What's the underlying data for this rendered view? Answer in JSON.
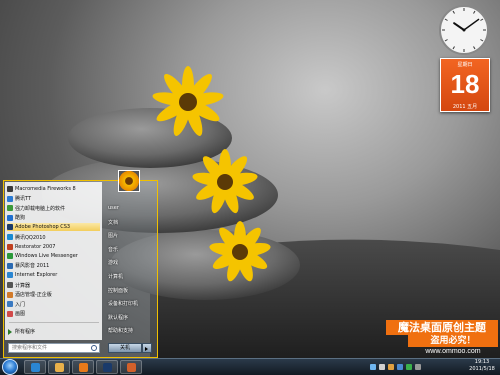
{
  "gadgets": {
    "calendar": {
      "weekday": "星期日",
      "day": "18",
      "year_month": "2011 五月"
    },
    "clock": {
      "hour": 10,
      "minute": 9
    }
  },
  "start_menu": {
    "programs": [
      {
        "label": "Macromedia Fireworks 8",
        "color": "#3a3a3a"
      },
      {
        "label": "腾讯TT",
        "color": "#2a7ad2"
      },
      {
        "label": "强力卸载电脑上的软件",
        "color": "#3a9a3a"
      },
      {
        "label": "酷狗",
        "color": "#1f6fd0"
      },
      {
        "label": "Adobe Photoshop CS3",
        "color": "#1a3a6a",
        "highlighted": true
      },
      {
        "label": "腾讯QQ2010",
        "color": "#1a8ad2"
      },
      {
        "label": "Restorator 2007",
        "color": "#c04020"
      },
      {
        "label": "Windows Live Messenger",
        "color": "#2a9a3a"
      },
      {
        "label": "暴风影音 2011",
        "color": "#2a6ab2"
      },
      {
        "label": "Internet Explorer",
        "color": "#2a86d2"
      },
      {
        "label": "计算器",
        "color": "#555"
      },
      {
        "label": "酒店管理-正企版",
        "color": "#d27a2a"
      },
      {
        "label": "入门",
        "color": "#3a7ac2"
      },
      {
        "label": "画图",
        "color": "#d24a4a"
      }
    ],
    "all_programs": "所有程序",
    "search_placeholder": "搜索程序和文件",
    "right_items": [
      "user",
      "文档",
      "图片",
      "音乐",
      "游戏",
      "计算机",
      "控制面板",
      "设备和打印机",
      "默认程序",
      "帮助和支持"
    ],
    "shutdown_label": "关机"
  },
  "watermark": {
    "line1": "魔法桌面原创主题",
    "line2": "盗用必究！",
    "line3": "www.ommoo.com"
  },
  "taskbar": {
    "time": "19:13",
    "date": "2011/5/18",
    "buttons": [
      {
        "name": "ie-icon",
        "color": "#2a86d2"
      },
      {
        "name": "folder-icon",
        "color": "#e8b04a"
      },
      {
        "name": "media-player-icon",
        "color": "#e87a1a"
      },
      {
        "name": "photoshop-icon",
        "color": "#1a3a6a"
      },
      {
        "name": "firefox-icon",
        "color": "#d2602a"
      }
    ]
  }
}
